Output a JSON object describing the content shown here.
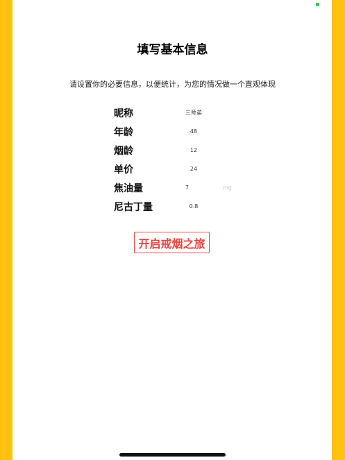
{
  "header": {
    "title": "填写基本信息",
    "subtitle": "请设置你的必要信息，以便统计，为您的情况做一个直观体现"
  },
  "form": {
    "nickname": {
      "label": "昵称",
      "value": "三师弟"
    },
    "age": {
      "label": "年龄",
      "value": "48"
    },
    "smoking_years": {
      "label": "烟龄",
      "value": "12"
    },
    "unit_price": {
      "label": "单价",
      "value": "24"
    },
    "tar": {
      "label": "焦油量",
      "value": "7",
      "unit_placeholder": "mg"
    },
    "nicotine": {
      "label": "尼古丁量",
      "value": "0.8"
    }
  },
  "actions": {
    "start_label": "开启戒烟之旅"
  },
  "colors": {
    "side_bars": "#ffc20e",
    "accent": "#e7453f",
    "status_dot": "#3ac45a"
  }
}
